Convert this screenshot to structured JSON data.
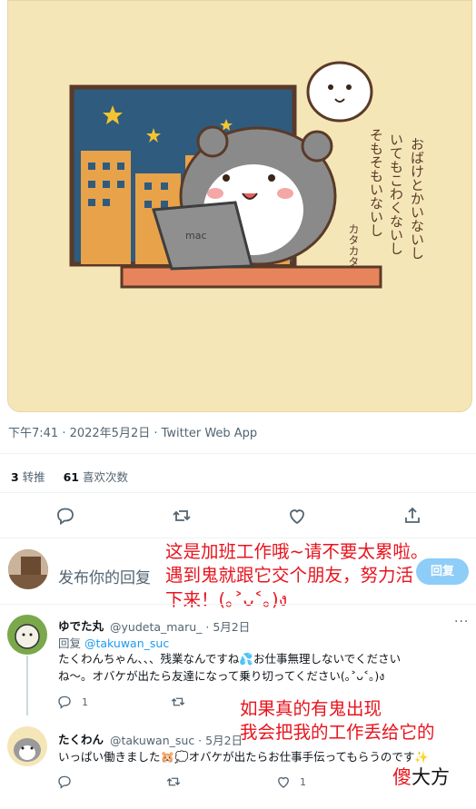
{
  "tweet": {
    "meta": "下午7:41 · 2022年5月2日 · Twitter Web App",
    "retweets_count": "3",
    "retweets_label": " 转推",
    "likes_count": "61",
    "likes_label": " 喜欢次数"
  },
  "reply_box": {
    "placeholder": "发布你的回复",
    "button_label": "回复"
  },
  "replies": [
    {
      "name": "ゆでた丸",
      "handle": "@yudeta_maru_ · 5月2日",
      "reply_to_prefix": "回复 ",
      "reply_to": "@takuwan_suc",
      "text_line1": "たくわんちゃん、、、残業なんですね💦お仕事無理しないでください",
      "text_line2": "ね〜。オバケが出たら友達になって乗り切ってください(｡˃ᴗ˂｡)ง",
      "reply_count": "1",
      "like_count": ""
    },
    {
      "name": "たくわん",
      "handle": "@takuwan_suc · 5月2日",
      "text_line1": "いっぱい働きました🐹💭オバケが出たらお仕事手伝ってもらうのです✨",
      "reply_count": "",
      "like_count": "1"
    }
  ],
  "annotations": {
    "a1_line1": "这是加班工作哦~请不要太累啦。",
    "a1_line2": "遇到鬼就跟它交个朋友，努力活",
    "a1_line3": "下来！(｡˃ᴗ˂｡)ง",
    "a2_line1": "如果真的有鬼出现",
    "a2_line2": "我会把我的工作丢给它的"
  },
  "image": {
    "laptop_text": "mac",
    "ghost_text_1": "おばけとかいないし",
    "ghost_text_2": "いてもこわくないし",
    "ghost_text_3": "そもそもいないし",
    "ghost_sfx": "カタカタ"
  },
  "watermark": {
    "part1": "傻",
    "part2": "大方"
  },
  "colors": {
    "accent": "#1d9bf0",
    "annotation": "#e8141e",
    "media_bg": "#f5e6b8"
  }
}
